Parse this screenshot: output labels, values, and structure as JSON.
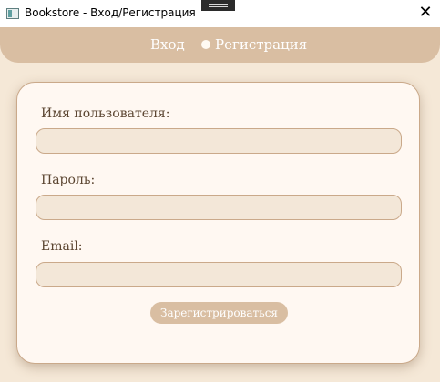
{
  "window": {
    "title": "Bookstore - Вход/Регистрация",
    "close_icon": "✕"
  },
  "nav": {
    "login_label": "Вход",
    "register_label": "Регистрация"
  },
  "form": {
    "username_label": "Имя пользователя:",
    "password_label": "Пароль:",
    "email_label": "Email:",
    "username_value": "",
    "password_value": "",
    "email_value": "",
    "submit_label": "Зарегистрироваться"
  },
  "colors": {
    "accent": "#d9bea2",
    "background": "#f5e8d7",
    "card": "#fff8f2",
    "field": "#f3e7d8",
    "border": "#caa98a",
    "text": "#5c4632"
  }
}
